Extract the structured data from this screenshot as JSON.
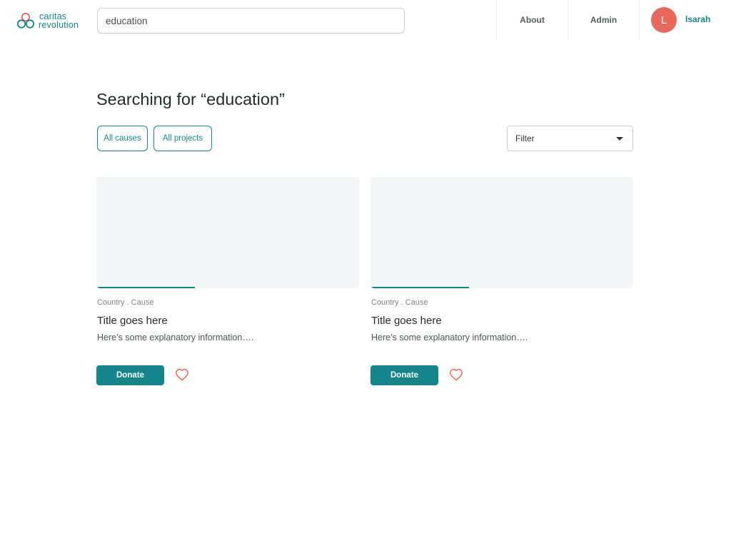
{
  "brand": {
    "line1": "caritas",
    "line2": "revolution",
    "color": "#14868b",
    "accent": "#e8695b"
  },
  "search": {
    "value": "education",
    "icon": "none"
  },
  "nav": {
    "about": "About",
    "admin": "Admin"
  },
  "user": {
    "initial": "L",
    "name": "lsarah",
    "avatar_color": "#e8695b"
  },
  "main": {
    "heading": "Searching for “education”",
    "filters": {
      "causes": "All causes",
      "projects": "All projects"
    },
    "filter_select": {
      "selected": "Filter"
    }
  },
  "cards": [
    {
      "meta": "Country . Cause",
      "title": "Title goes here",
      "description": "Here’s some explanatory information….",
      "donate_label": "Donate",
      "progress": 0.375,
      "icon": "heart-icon"
    },
    {
      "meta": "Country . Cause",
      "title": "Title goes here",
      "description": "Here’s some explanatory information….",
      "donate_label": "Donate",
      "progress": 0.375,
      "icon": "heart-icon"
    }
  ]
}
